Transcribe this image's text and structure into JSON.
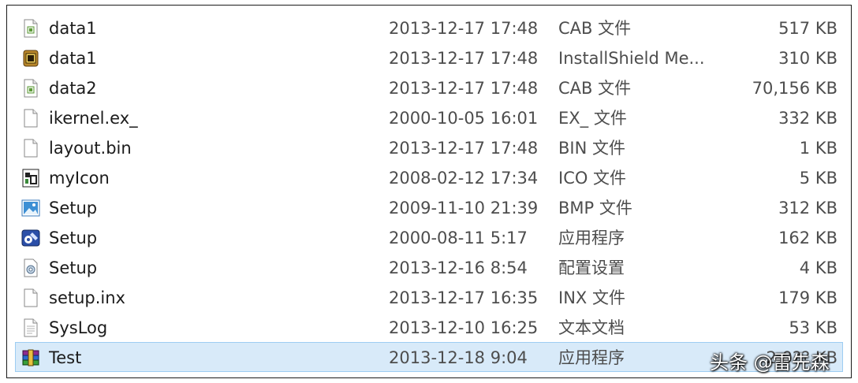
{
  "files": [
    {
      "name": "data1",
      "date": "2013-12-17 17:48",
      "type": "CAB 文件",
      "size": "517 KB",
      "icon": "cab-file-icon"
    },
    {
      "name": "data1",
      "date": "2013-12-17 17:48",
      "type": "InstallShield Me...",
      "size": "310 KB",
      "icon": "installshield-file-icon"
    },
    {
      "name": "data2",
      "date": "2013-12-17 17:48",
      "type": "CAB 文件",
      "size": "70,156 KB",
      "icon": "cab-file-icon"
    },
    {
      "name": "ikernel.ex_",
      "date": "2000-10-05 16:01",
      "type": "EX_ 文件",
      "size": "332 KB",
      "icon": "blank-file-icon"
    },
    {
      "name": "layout.bin",
      "date": "2013-12-17 17:48",
      "type": "BIN 文件",
      "size": "1 KB",
      "icon": "blank-file-icon"
    },
    {
      "name": "myIcon",
      "date": "2008-02-12 17:34",
      "type": "ICO 文件",
      "size": "5 KB",
      "icon": "ico-file-icon"
    },
    {
      "name": "Setup",
      "date": "2009-11-10 21:39",
      "type": "BMP 文件",
      "size": "312 KB",
      "icon": "bitmap-image-icon"
    },
    {
      "name": "Setup",
      "date": "2000-08-11 5:17",
      "type": "应用程序",
      "size": "162 KB",
      "icon": "setup-application-icon"
    },
    {
      "name": "Setup",
      "date": "2013-12-16 8:54",
      "type": "配置设置",
      "size": "4 KB",
      "icon": "config-settings-icon"
    },
    {
      "name": "setup.inx",
      "date": "2013-12-17 16:35",
      "type": "INX 文件",
      "size": "179 KB",
      "icon": "blank-file-icon"
    },
    {
      "name": "SysLog",
      "date": "2013-12-10 16:25",
      "type": "文本文档",
      "size": "53 KB",
      "icon": "text-document-icon"
    },
    {
      "name": "Test",
      "date": "2013-12-18 9:04",
      "type": "应用程序",
      "size": "2,0?? KB",
      "icon": "winrar-application-icon",
      "selected": true
    }
  ],
  "watermark": "头条 @雷先森",
  "colors": {
    "selection_bg": "#d8eaf9",
    "selection_border": "#9dcdf2",
    "text": "#1b1b1b",
    "meta_text": "#4d4d4d"
  }
}
